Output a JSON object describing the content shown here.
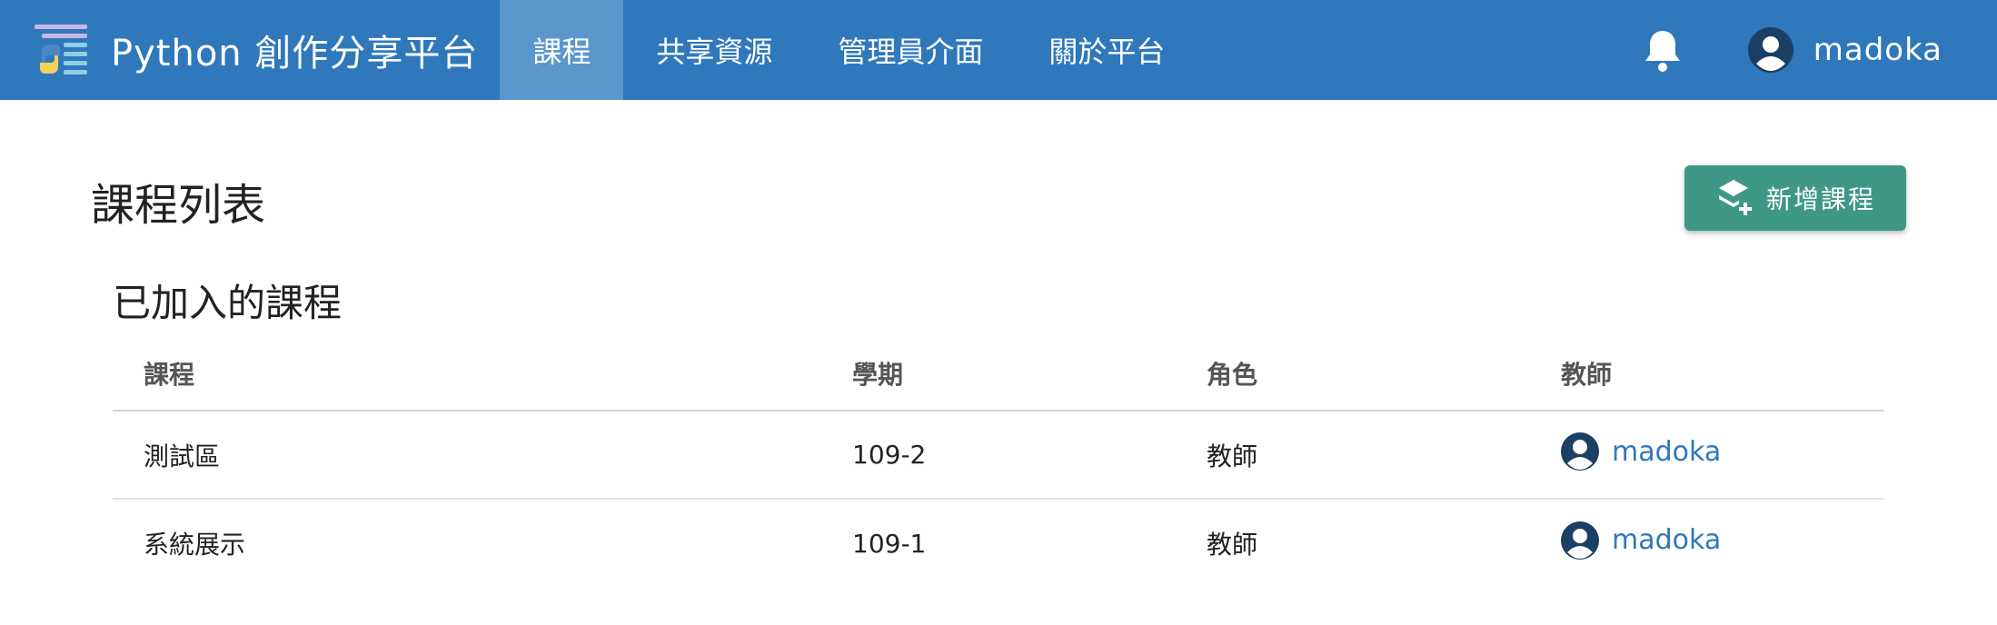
{
  "navbar": {
    "brand": "Python 創作分享平台",
    "items": [
      {
        "label": "課程"
      },
      {
        "label": "共享資源"
      },
      {
        "label": "管理員介面"
      },
      {
        "label": "關於平台"
      }
    ],
    "active_index": 0,
    "user_name": "madoka",
    "icons": {
      "notifications": "bell-icon",
      "user": "user-avatar-icon"
    }
  },
  "page": {
    "title": "課程列表",
    "add_course_label": "新增課程",
    "add_course_icon": "layers-plus-icon"
  },
  "joined_courses": {
    "title": "已加入的課程",
    "columns": [
      "課程",
      "學期",
      "角色",
      "教師"
    ],
    "rows": [
      {
        "course": "測試區",
        "term": "109-2",
        "role": "教師",
        "teacher": "madoka"
      },
      {
        "course": "系統展示",
        "term": "109-1",
        "role": "教師",
        "teacher": "madoka"
      }
    ]
  },
  "colors": {
    "navbar": "#2f78bb",
    "nav_active": "#5b97cc",
    "primary_button": "#3f9887",
    "link": "#2f78bb",
    "avatar": "#1c3f66"
  }
}
